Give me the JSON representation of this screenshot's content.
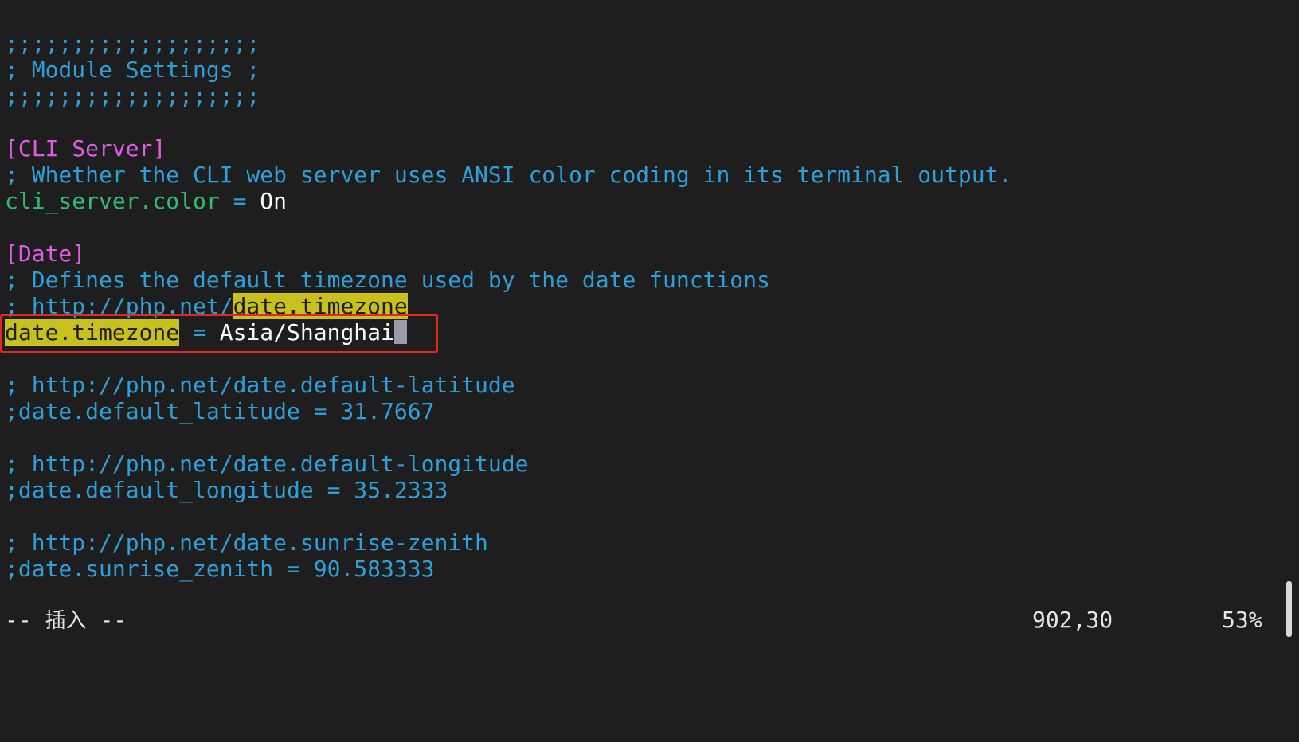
{
  "editor": {
    "lines": {
      "l1": ";;;;;;;;;;;;;;;;;;;",
      "l2": "; Module Settings ;",
      "l3": ";;;;;;;;;;;;;;;;;;;",
      "l5": "[CLI Server]",
      "l6": "; Whether the CLI web server uses ANSI color coding in its terminal output.",
      "l7_key": "cli_server.color",
      "l7_op": " = ",
      "l7_val": "On",
      "l9": "[Date]",
      "l10": "; Defines the default timezone used by the date functions",
      "l11_prefix": "; http://php.net/",
      "l11_match": "date.timezone",
      "l12_key": "date.timezone",
      "l12_op": " = ",
      "l12_val": "Asia/Shangha",
      "l12_cursor_char": "i",
      "l14": "; http://php.net/date.default-latitude",
      "l15": ";date.default_latitude = 31.7667",
      "l17": "; http://php.net/date.default-longitude",
      "l18": ";date.default_longitude = 35.2333",
      "l20": "; http://php.net/date.sunrise-zenith",
      "l21": ";date.sunrise_zenith = 90.583333"
    }
  },
  "status": {
    "mode_prefix": "-- ",
    "mode": "插入",
    "mode_suffix": " --",
    "position": "902,30",
    "percent": "53%"
  },
  "colors": {
    "background": "#1e1e1e",
    "comment": "#2d9fd9",
    "section": "#e05ce6",
    "key": "#2fbf71",
    "search_highlight": "#c8c01c",
    "annotation_box": "#e8251f"
  }
}
